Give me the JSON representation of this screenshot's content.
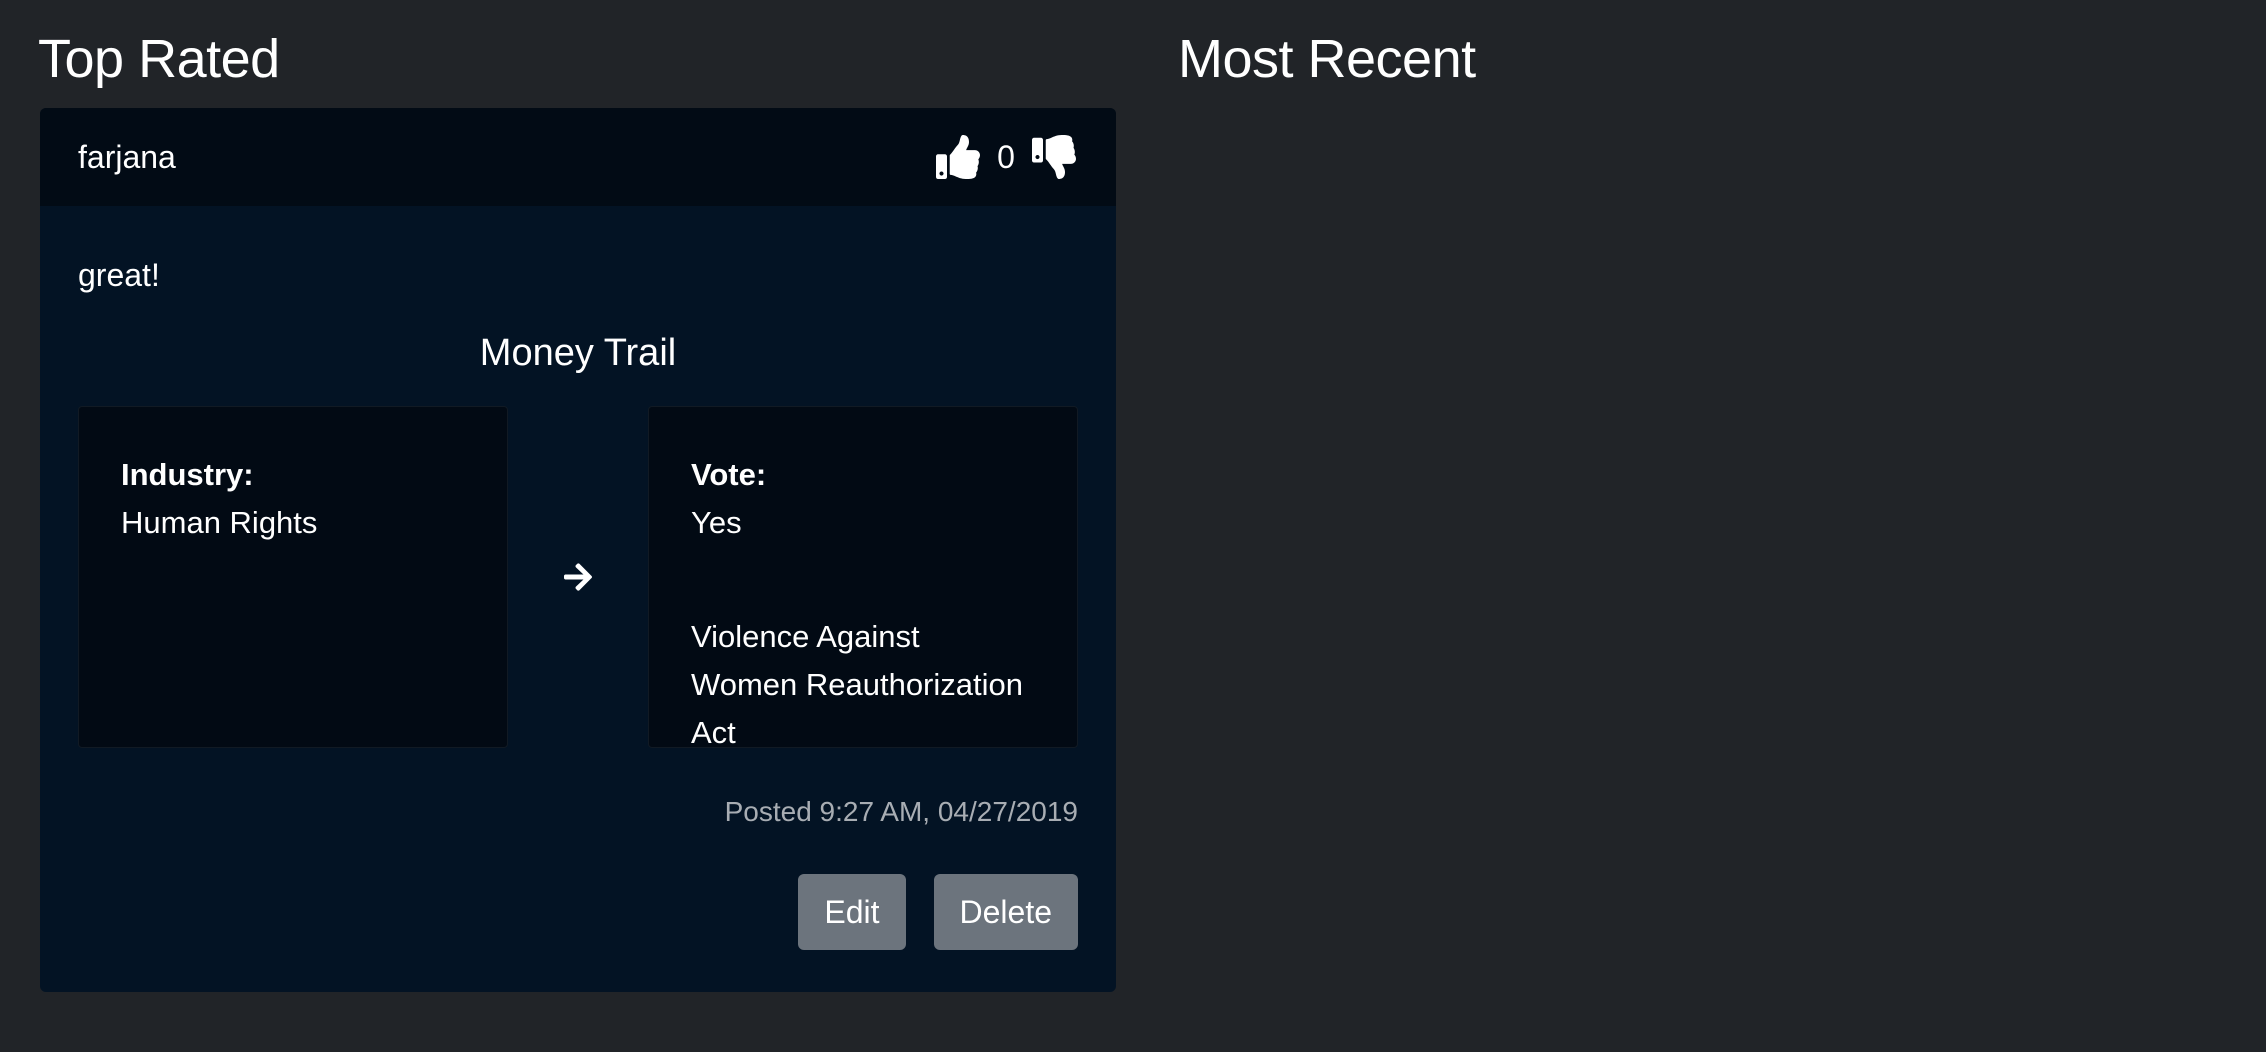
{
  "sections": {
    "top_rated": {
      "heading": "Top Rated",
      "posts": [
        {
          "username": "farjana",
          "score": "0",
          "comment": "great!",
          "trail": {
            "title": "Money Trail",
            "industry_label": "Industry:",
            "industry_value": "Human Rights",
            "vote_label": "Vote:",
            "vote_value": "Yes",
            "bill_lines": [
              "Violence Against",
              "Women Reauthorization",
              "Act"
            ]
          },
          "posted": "Posted 9:27 AM, 04/27/2019",
          "edit_label": "Edit",
          "delete_label": "Delete"
        }
      ]
    },
    "most_recent": {
      "heading": "Most Recent"
    }
  },
  "icons": {
    "upvote": "thumbs-up-icon",
    "downvote": "thumbs-down-icon",
    "arrow": "arrow-right-icon"
  },
  "colors": {
    "page_background": "#212428",
    "card_background": "#031324",
    "card_header_background": "#020b15",
    "button_background": "#6c747d",
    "muted_text": "#a8adb3"
  }
}
